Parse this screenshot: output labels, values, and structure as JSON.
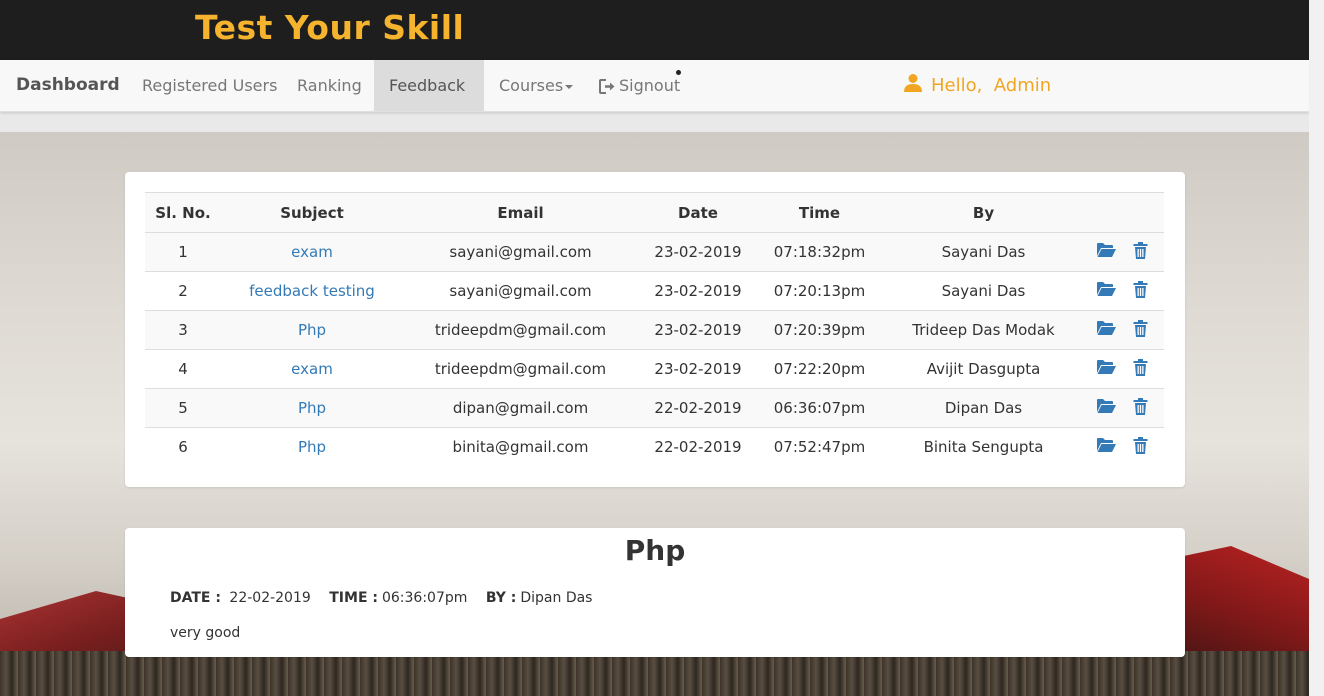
{
  "brand": "Test Your Skill",
  "nav": {
    "dashboard": "Dashboard",
    "registered_users": "Registered Users",
    "ranking": "Ranking",
    "feedback": "Feedback",
    "courses": "Courses",
    "signout": "Signout",
    "greeting": "Hello,  Admin"
  },
  "table": {
    "headers": [
      "Sl. No.",
      "Subject",
      "Email",
      "Date",
      "Time",
      "By"
    ],
    "rows": [
      {
        "no": "1",
        "subject": "exam",
        "email": "sayani@gmail.com",
        "date": "23-02-2019",
        "time": "07:18:32pm",
        "by": "Sayani Das"
      },
      {
        "no": "2",
        "subject": "feedback testing",
        "email": "sayani@gmail.com",
        "date": "23-02-2019",
        "time": "07:20:13pm",
        "by": "Sayani Das"
      },
      {
        "no": "3",
        "subject": "Php",
        "email": "trideepdm@gmail.com",
        "date": "23-02-2019",
        "time": "07:20:39pm",
        "by": "Trideep Das Modak"
      },
      {
        "no": "4",
        "subject": "exam",
        "email": "trideepdm@gmail.com",
        "date": "23-02-2019",
        "time": "07:22:20pm",
        "by": "Avijit Dasgupta"
      },
      {
        "no": "5",
        "subject": "Php",
        "email": "dipan@gmail.com",
        "date": "22-02-2019",
        "time": "06:36:07pm",
        "by": "Dipan Das"
      },
      {
        "no": "6",
        "subject": "Php",
        "email": "binita@gmail.com",
        "date": "22-02-2019",
        "time": "07:52:47pm",
        "by": "Binita Sengupta"
      }
    ]
  },
  "feedback_detail": {
    "title": "Php",
    "date_label": "DATE :",
    "date": "22-02-2019",
    "time_label": "TIME :",
    "time": "06:36:07pm",
    "by_label": "BY :",
    "by": "Dipan Das",
    "message": "very good"
  },
  "colors": {
    "brand": "#f6b32e",
    "link": "#337ab7",
    "greeting": "#f0a623",
    "action_icon": "#337ab7"
  }
}
